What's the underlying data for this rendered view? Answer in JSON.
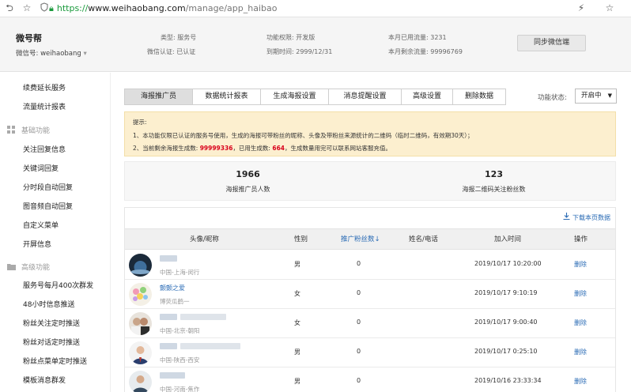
{
  "browser": {
    "scheme": "https://",
    "host": "www.weihaobang.com",
    "path": "/manage/app_haibao"
  },
  "header": {
    "brand": "微号帮",
    "account_label": "微信号: weihaobang",
    "type": "类型: 服务号",
    "verify": "微信认证: 已认证",
    "permission": "功能权限: 开发版",
    "expire": "到期时间: 2999/12/31",
    "used_flow": "本月已用流量: 3231",
    "remain_flow": "本月剩余流量: 99996769",
    "sync_button": "同步微信端"
  },
  "sidebar": {
    "top_items": [
      "续费延长服务",
      "流量统计报表"
    ],
    "basic_section": "基础功能",
    "basic_items": [
      "关注回复信息",
      "关键词回复",
      "分时段自动回复",
      "图音频自动回复",
      "自定义菜单",
      "开屏信息"
    ],
    "advanced_section": "高级功能",
    "advanced_items": [
      "服务号每月400次群发",
      "48小时信息推送",
      "粉丝关注定时推送",
      "粉丝对话定时推送",
      "粉丝点菜单定时推送",
      "模板消息群发"
    ]
  },
  "tabs": [
    {
      "label": "海报推广员",
      "active": true
    },
    {
      "label": "数据统计报表",
      "active": false
    },
    {
      "label": "生成海报设置",
      "active": false
    },
    {
      "label": "消息提醒设置",
      "active": false
    },
    {
      "label": "高级设置",
      "active": false
    },
    {
      "label": "删除数据",
      "active": false
    }
  ],
  "status": {
    "label": "功能状态:",
    "value": "开启中"
  },
  "notice": {
    "title": "提示:",
    "line1": "1、本功能仅限已认证的服务号使用，生成的海报可带粉丝的昵称、头像及带粉丝来源统计的二维码（临时二维码，有效期30天）；",
    "line2_a": "2、当前剩余海报生成数: ",
    "line2_remaining": "99999336",
    "line2_b": "，已用生成数: ",
    "line2_used": "664",
    "line2_c": "，生成数量用完可以联系网站客服充值。"
  },
  "stats": {
    "promoters_count": "1966",
    "promoters_label": "海报推广员人数",
    "followers_count": "123",
    "followers_label": "海报二维码关注粉丝数"
  },
  "table": {
    "download": "下载本页数据",
    "columns": [
      "头像/昵称",
      "性别",
      "推广粉丝数↓",
      "姓名/电话",
      "加入时间",
      "操作"
    ],
    "rows": [
      {
        "nickname": "",
        "location": "中国-上海-闵行",
        "gender": "男",
        "fans": "0",
        "name_phone": "",
        "time": "2019/10/17 10:20:00",
        "action": "删除"
      },
      {
        "nickname": "颤颤之爱",
        "location": "博荧瓜鹤一",
        "gender": "女",
        "fans": "0",
        "name_phone": "",
        "time": "2019/10/17 9:10:19",
        "action": "删除"
      },
      {
        "nickname": "",
        "location": "中国-北京-朝阳",
        "gender": "女",
        "fans": "0",
        "name_phone": "",
        "time": "2019/10/17 9:00:40",
        "action": "删除"
      },
      {
        "nickname": "",
        "location": "中国-陕西-西安",
        "gender": "男",
        "fans": "0",
        "name_phone": "",
        "time": "2019/10/17 0:25:10",
        "action": "删除"
      },
      {
        "nickname": "",
        "location": "中国-河南-焦作",
        "gender": "男",
        "fans": "0",
        "name_phone": "",
        "time": "2019/10/16 23:33:34",
        "action": "删除"
      }
    ]
  },
  "colors": {
    "link": "#2a6bb5",
    "notice_bg": "#fcefcf",
    "highlight_red": "#d9001b",
    "url_green": "#1a9a3c"
  },
  "icons": [
    "back-icon",
    "star-icon",
    "shield-icon",
    "lock-icon",
    "flash-icon",
    "star-outline-icon",
    "grid-icon",
    "folder-icon",
    "download-icon",
    "chevron-down-icon"
  ]
}
